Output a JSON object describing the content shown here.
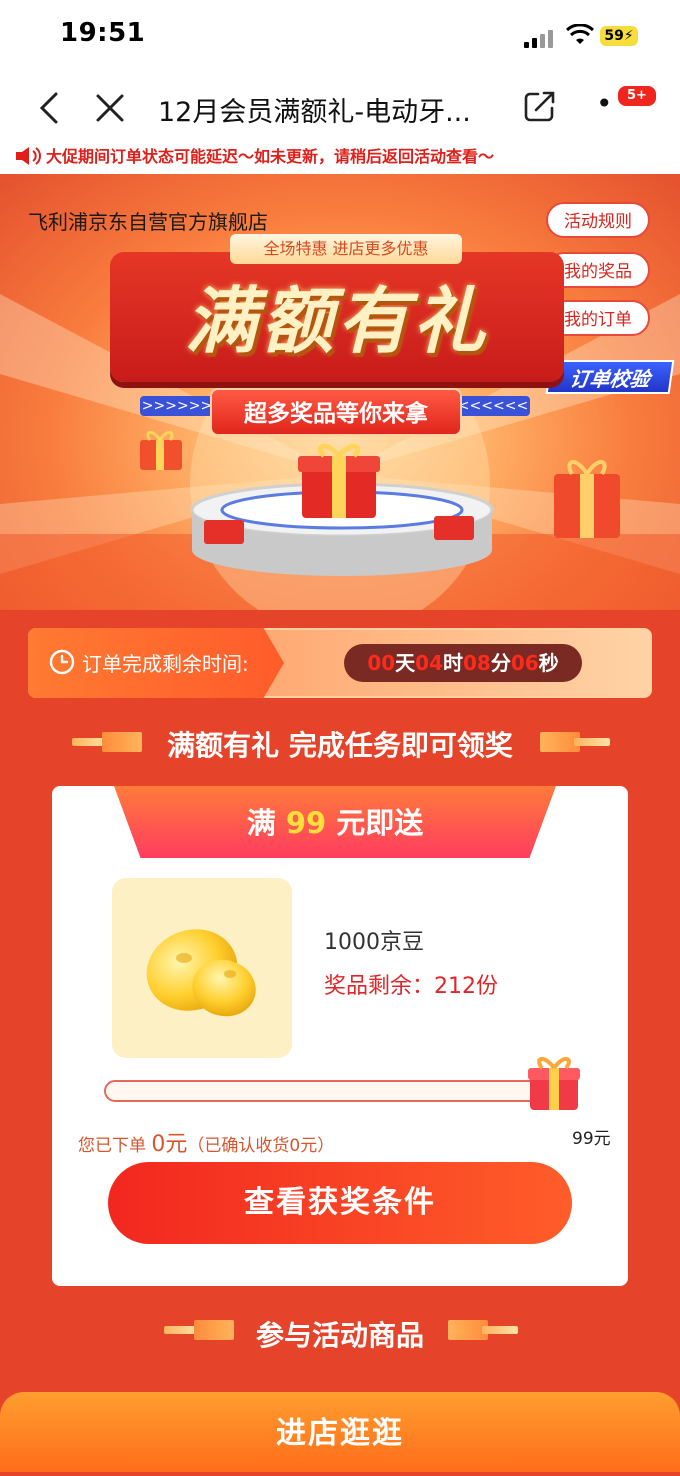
{
  "status_bar": {
    "time": "19:51",
    "battery": "59"
  },
  "nav": {
    "title": "12月会员满额礼-电动牙...",
    "badge": "5+"
  },
  "notice": {
    "text": "大促期间订单状态可能延迟～如未更新，请稍后返回活动查看～"
  },
  "banner": {
    "store_name": "飞利浦京东自营官方旗舰店",
    "top_tag": "全场特惠 进店更多优惠",
    "title": "满额有礼",
    "subtitle": "超多奖品等你来拿",
    "arrows_left": ">>>>>>",
    "arrows_right": "<<<<<<",
    "buttons": {
      "rules": "活动规则",
      "prizes": "我的奖品",
      "orders": "我的订单"
    },
    "verify_tag": "订单校验"
  },
  "timer": {
    "label": "订单完成剩余时间:",
    "days": "00",
    "days_unit": "天",
    "hours": "04",
    "hours_unit": "时",
    "minutes": "08",
    "minutes_unit": "分",
    "seconds": "06",
    "seconds_unit": "秒"
  },
  "task_section": {
    "title": "满额有礼 完成任务即可领奖"
  },
  "card": {
    "tab_prefix": "满",
    "tab_amount": "99",
    "tab_suffix": "元即送",
    "prize_name": "1000京豆",
    "prize_remaining": "奖品剩余：212份",
    "progress_fraction": 0.0,
    "progress_prefix": "您已下单",
    "progress_amount": "0元",
    "progress_confirmed": "（已确认收货0元）",
    "progress_target": "99元",
    "cta": "查看获奖条件"
  },
  "products_section": {
    "title": "参与活动商品"
  },
  "bottom": {
    "button": "进店逛逛"
  },
  "colors": {
    "accent": "#e5432a",
    "cta": "#f2271f",
    "bottom": "#ff8a25"
  }
}
